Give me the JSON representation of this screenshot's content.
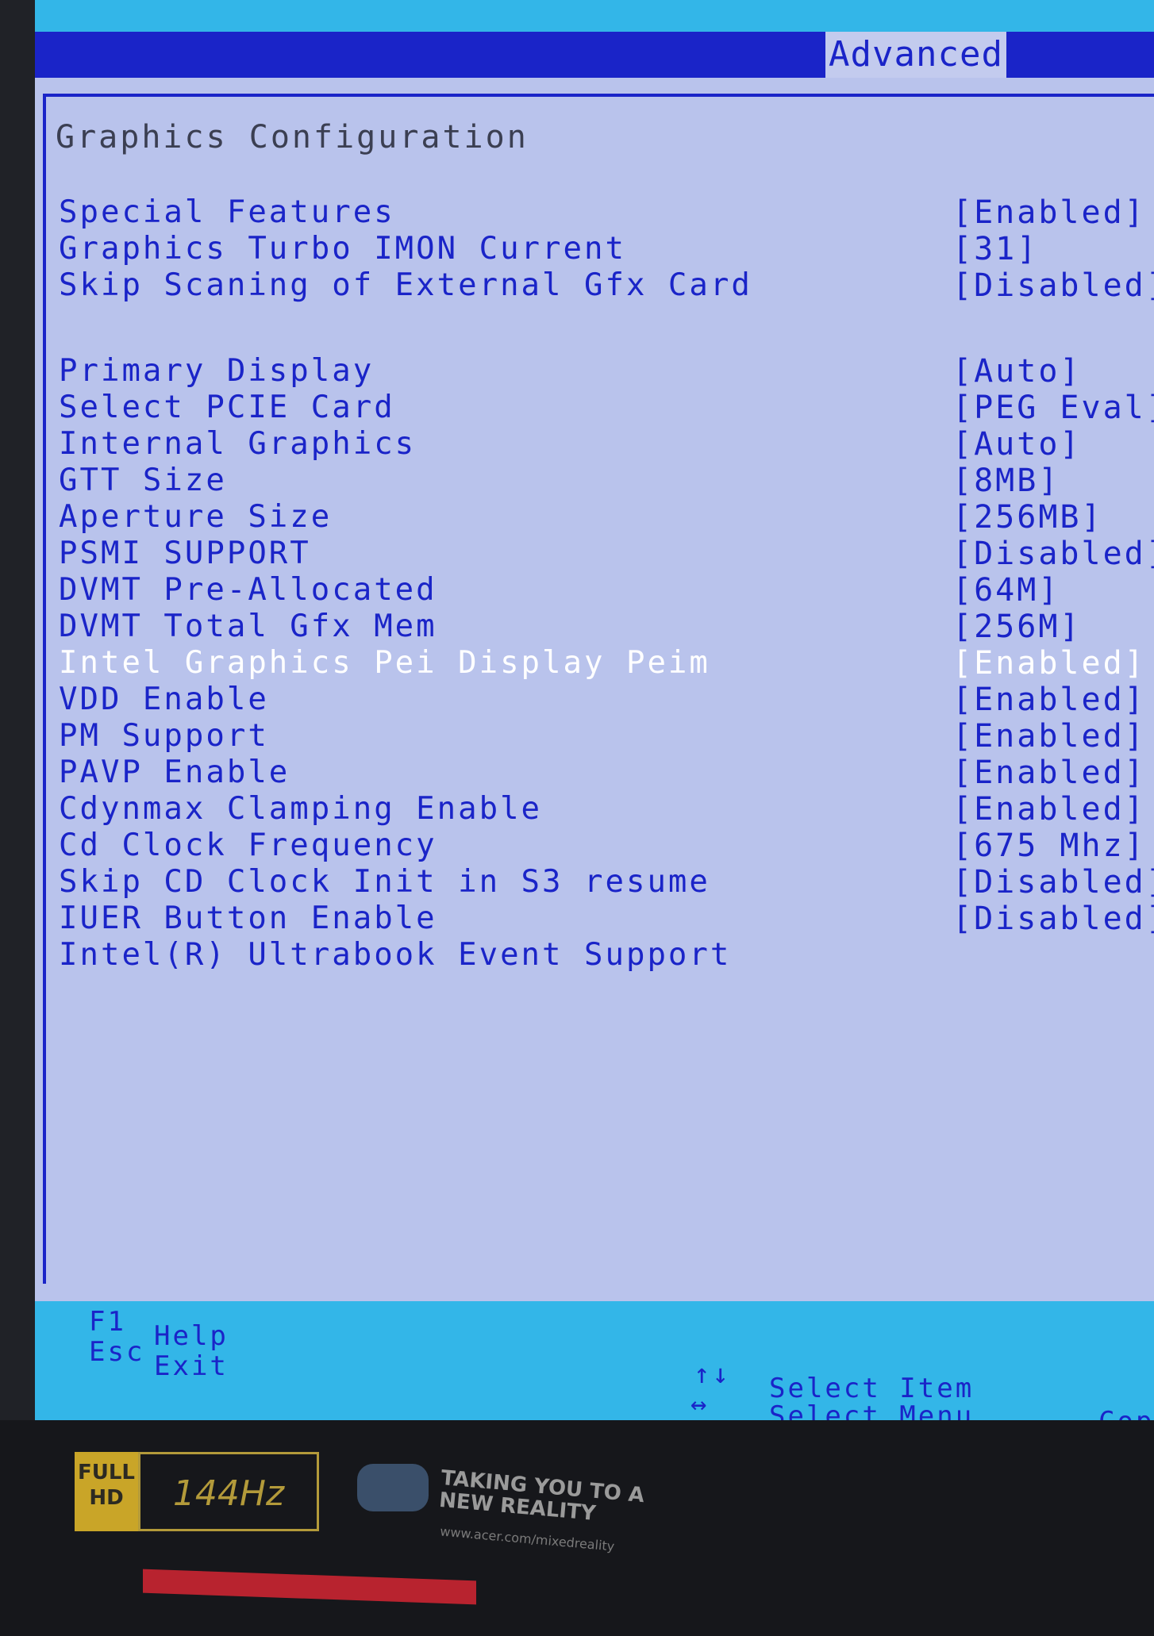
{
  "header": {
    "active_tab": "Advanced"
  },
  "page": {
    "title": "Graphics Configuration"
  },
  "settings": [
    {
      "label": "Special Features",
      "value": "[Enabled]"
    },
    {
      "label": "Graphics Turbo IMON Current",
      "value": "[31]"
    },
    {
      "label": "Skip Scaning of External Gfx Card",
      "value": "[Disabled]"
    },
    {
      "label": "Primary Display",
      "value": "[Auto]"
    },
    {
      "label": "Select PCIE Card",
      "value": "[PEG Eval]"
    },
    {
      "label": "Internal Graphics",
      "value": "[Auto]"
    },
    {
      "label": "GTT Size",
      "value": "[8MB]"
    },
    {
      "label": "Aperture Size",
      "value": "[256MB]"
    },
    {
      "label": "PSMI SUPPORT",
      "value": "[Disabled]"
    },
    {
      "label": "DVMT Pre-Allocated",
      "value": "[64M]"
    },
    {
      "label": "DVMT Total Gfx Mem",
      "value": "[256M]"
    },
    {
      "label": "Intel Graphics Pei Display Peim",
      "value": "[Enabled]",
      "selected": true
    },
    {
      "label": "VDD Enable",
      "value": "[Enabled]"
    },
    {
      "label": "PM Support",
      "value": "[Enabled]"
    },
    {
      "label": "PAVP Enable",
      "value": "[Enabled]"
    },
    {
      "label": "Cdynmax Clamping Enable",
      "value": "[Enabled]"
    },
    {
      "label": "Cd Clock Frequency",
      "value": "[675 Mhz]"
    },
    {
      "label": "Skip CD Clock Init in S3 resume",
      "value": "[Disabled]"
    },
    {
      "label": "IUER Button Enable",
      "value": "[Disabled]"
    },
    {
      "label": "Intel(R) Ultrabook Event Support",
      "value": ""
    }
  ],
  "help_bar": {
    "f1_key": "F1",
    "f1_text": "Help",
    "esc_key": "Esc",
    "esc_text": "Exit",
    "updown_key": "↑↓",
    "updown_text": "Select Item",
    "leftright_key": "↔",
    "leftright_text": "Select Menu",
    "copyright_fragment": "Cop"
  },
  "monitor": {
    "badge_full": "FULL",
    "badge_hd": "HD",
    "badge_refresh": "144Hz",
    "tagline_line1": "TAKING YOU TO A",
    "tagline_line2": "NEW REALITY",
    "tagline_url": "www.acer.com/mixedreality"
  }
}
